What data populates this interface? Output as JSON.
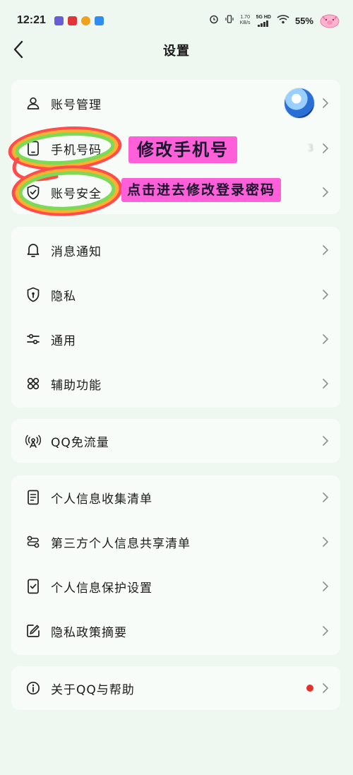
{
  "status_bar": {
    "time": "12:21",
    "net_speed": "1.70",
    "net_unit": "KB/s",
    "signal_label": "5G HD",
    "battery": "55%"
  },
  "header": {
    "title": "设置"
  },
  "sections": [
    {
      "items": [
        {
          "label": "账号管理",
          "icon": "person-icon"
        },
        {
          "label": "手机号码",
          "icon": "phone-icon",
          "value": "3"
        },
        {
          "label": "账号安全",
          "icon": "shield-check-icon"
        }
      ]
    },
    {
      "items": [
        {
          "label": "消息通知",
          "icon": "bell-icon"
        },
        {
          "label": "隐私",
          "icon": "privacy-shield-icon"
        },
        {
          "label": "通用",
          "icon": "sliders-icon"
        },
        {
          "label": "辅助功能",
          "icon": "grid-clover-icon"
        }
      ]
    },
    {
      "items": [
        {
          "label": "QQ免流量",
          "icon": "antenna-icon"
        }
      ]
    },
    {
      "items": [
        {
          "label": "个人信息收集清单",
          "icon": "document-list-icon"
        },
        {
          "label": "第三方个人信息共享清单",
          "icon": "share-link-icon"
        },
        {
          "label": "个人信息保护设置",
          "icon": "checkbox-doc-icon"
        },
        {
          "label": "隐私政策摘要",
          "icon": "edit-doc-icon"
        }
      ]
    },
    {
      "items": [
        {
          "label": "关于QQ与帮助",
          "icon": "info-icon"
        }
      ]
    }
  ],
  "annotations": {
    "phone": "修改手机号",
    "security": "点击进去修改登录密码"
  },
  "colors": {
    "background": "#eef8f1",
    "card": "#f7fcf8",
    "annotation_bg": "#ff5fd8",
    "red_dot": "#e8302a"
  }
}
